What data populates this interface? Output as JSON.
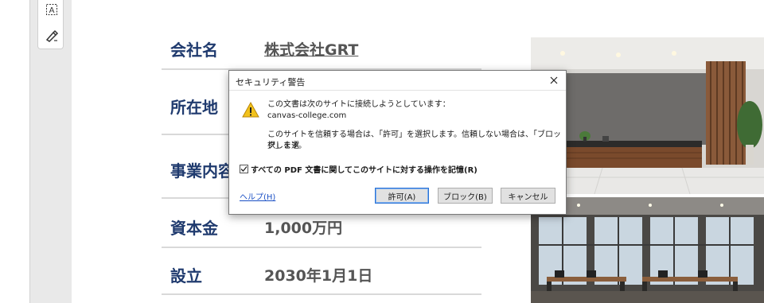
{
  "toolbar": {
    "tools": [
      {
        "icon": "text-box-select-icon"
      },
      {
        "icon": "sign-pen-icon"
      }
    ]
  },
  "company_info": {
    "rows": [
      {
        "label": "会社名",
        "value": "株式会社GRT"
      },
      {
        "label": "所在地",
        "value": ""
      },
      {
        "label": "事業内容",
        "value": ""
      },
      {
        "label": "資本金",
        "value": "1,000万円"
      },
      {
        "label": "設立",
        "value": "2030年1月1日"
      }
    ]
  },
  "dialog": {
    "title": "セキュリティ警告",
    "message_line1": "この文書は次のサイトに接続しようとしています：",
    "site": "canvas-college.com",
    "message_line3": "このサイトを信頼する場合は、「許可」を選択します。信頼しない場合は、「ブロック」を選",
    "message_line4": "択します。",
    "checkbox_label": "すべての PDF 文書に関してこのサイトに対する操作を記憶(R)",
    "checkbox_checked": true,
    "help_label": "ヘルプ(H)",
    "allow_label": "許可(A)",
    "block_label": "ブロック(B)",
    "cancel_label": "キャンセル"
  },
  "colors": {
    "heading": "#1f3a6e",
    "value_text": "#555555",
    "link": "#1a4fc4",
    "primary_border": "#2a72d4"
  }
}
